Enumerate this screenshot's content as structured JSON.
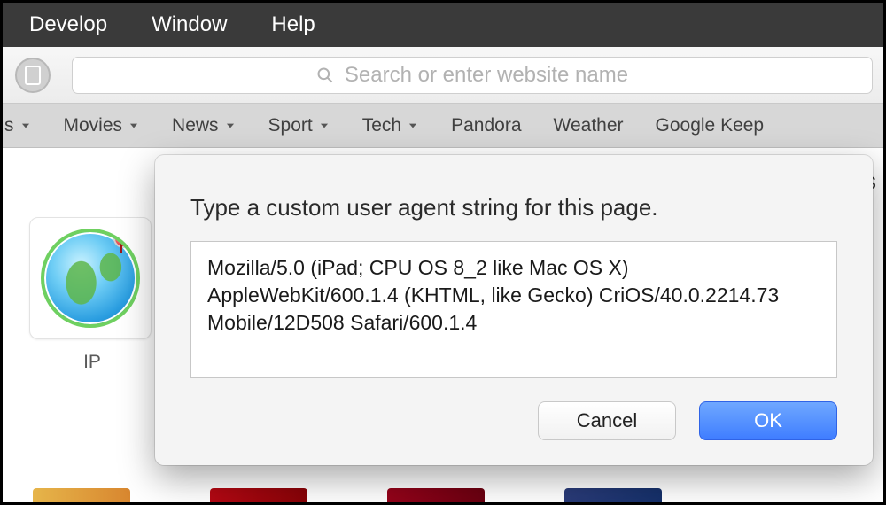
{
  "menubar": {
    "develop": "Develop",
    "window": "Window",
    "help": "Help"
  },
  "toolbar": {
    "search_placeholder": "Search or enter website name"
  },
  "bookmarks": {
    "first_chevron_only": "s",
    "items": [
      "Movies",
      "News",
      "Sport",
      "Tech",
      "Pandora",
      "Weather"
    ],
    "has_chevron": [
      true,
      true,
      true,
      true,
      false,
      false
    ],
    "last_cut": "Google Keep"
  },
  "sidebar": {
    "tile_label": "IP"
  },
  "peek": {
    "es": "es"
  },
  "dialog": {
    "title": "Type a custom user agent string for this page.",
    "ua_value": "Mozilla/5.0 (iPad; CPU OS 8_2 like Mac OS X) AppleWebKit/600.1.4 (KHTML, like Gecko) CriOS/40.0.2214.73 Mobile/12D508 Safari/600.1.4",
    "cancel": "Cancel",
    "ok": "OK"
  }
}
